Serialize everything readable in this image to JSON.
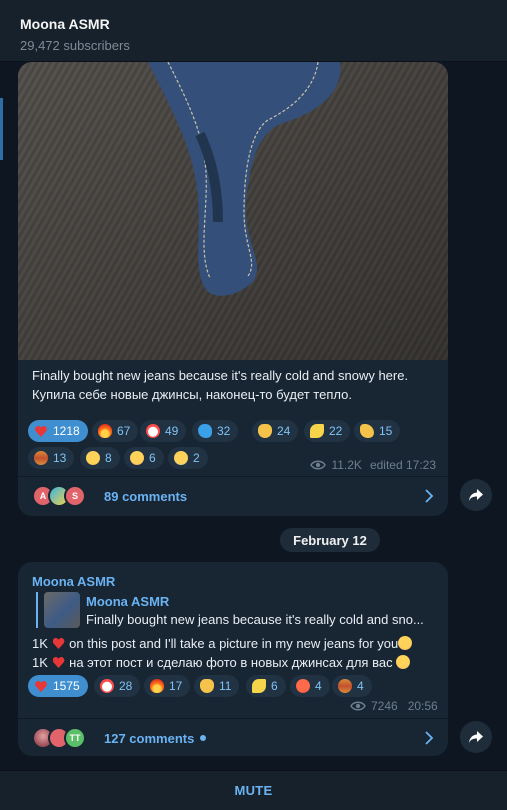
{
  "header": {
    "title": "Moona ASMR",
    "subscribers": "29,472 subscribers"
  },
  "post1": {
    "caption_en": "Finally bought new jeans because it's really cold and snowy here.",
    "caption_ru": "Купила себе новые джинсы, наконец-то будет тепло.",
    "reactions": [
      {
        "emoji": "heart",
        "count": "1218",
        "mine": true
      },
      {
        "emoji": "fire",
        "count": "67"
      },
      {
        "emoji": "clown",
        "count": "49"
      },
      {
        "emoji": "whale",
        "count": "32"
      },
      {
        "emoji": "thumbs-up",
        "count": "24"
      },
      {
        "emoji": "banana",
        "count": "22"
      },
      {
        "emoji": "salute",
        "count": "15"
      },
      {
        "emoji": "hotdog",
        "count": "13"
      },
      {
        "emoji": "thinking",
        "count": "8"
      },
      {
        "emoji": "love-face",
        "count": "6"
      },
      {
        "emoji": "crying",
        "count": "2"
      }
    ],
    "views": "11.2K",
    "edited": "edited 17:23",
    "comment_avatars": [
      "A",
      "",
      "S"
    ],
    "comments": "89 comments"
  },
  "date_separator": "February 12",
  "post2": {
    "sender": "Moona ASMR",
    "quote_name": "Moona ASMR",
    "quote_text": "Finally bought new jeans because it's really cold and sno...",
    "line_en_pre": "1K",
    "line_en_post": "on this post and I'll take a picture in my new jeans for you",
    "line_ru_pre": "1K",
    "line_ru_post": "на этот пост и сделаю фото в новых джинсах для вас",
    "reactions": [
      {
        "emoji": "heart",
        "count": "1575",
        "mine": true
      },
      {
        "emoji": "clown",
        "count": "28"
      },
      {
        "emoji": "fire",
        "count": "17"
      },
      {
        "emoji": "thumbs-up",
        "count": "11"
      },
      {
        "emoji": "banana",
        "count": "6"
      },
      {
        "emoji": "angry",
        "count": "4"
      },
      {
        "emoji": "hotdog",
        "count": "4"
      }
    ],
    "views": "7246",
    "time": "20:56",
    "comment_avatars": [
      "",
      "",
      "TT"
    ],
    "comments": "127 comments"
  },
  "bottom": {
    "mute": "MUTE"
  },
  "colors": {
    "accent": "#6ab3f3",
    "bubble": "#182533",
    "background": "#0e1621",
    "my_reaction": "#3f8fd0"
  }
}
